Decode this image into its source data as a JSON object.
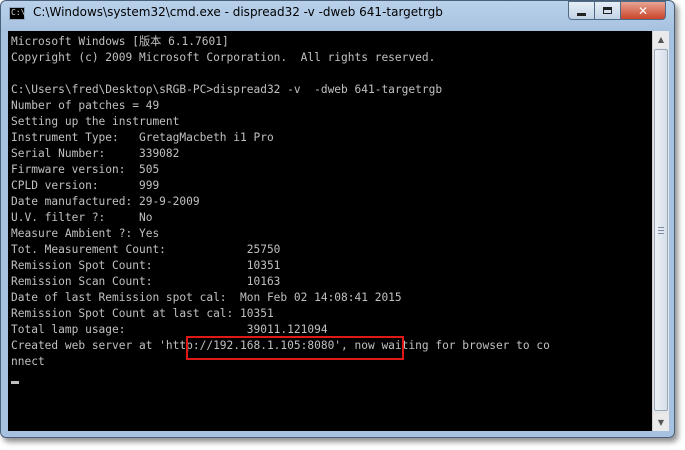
{
  "window": {
    "title": "C:\\Windows\\system32\\cmd.exe - dispread32  -v  -dweb 641-targetrgb",
    "app_icon_glyph": "C:\\"
  },
  "caption_buttons": {
    "minimize": "minimize",
    "maximize": "maximize",
    "close": "✕"
  },
  "console": {
    "lines": [
      "Microsoft Windows [版本 6.1.7601]",
      "Copyright (c) 2009 Microsoft Corporation.  All rights reserved.",
      "",
      "C:\\Users\\fred\\Desktop\\sRGB-PC>dispread32 -v  -dweb 641-targetrgb",
      "Number of patches = 49",
      "Setting up the instrument",
      "Instrument Type:   GretagMacbeth i1 Pro",
      "Serial Number:     339082",
      "Firmware version:  505",
      "CPLD version:      999",
      "Date manufactured: 29-9-2009",
      "U.V. filter ?:     No",
      "Measure Ambient ?: Yes",
      "Tot. Measurement Count:            25750",
      "Remission Spot Count:              10351",
      "Remission Scan Count:              10163",
      "Date of last Remission spot cal:  Mon Feb 02 14:08:41 2015",
      "Remission Spot Count at last cal: 10351",
      "Total lamp usage:                  39011.121094",
      "Created web server at 'http://192.168.1.105:8080', now waiting for browser to co",
      "nnect"
    ],
    "highlighted_url": "'http://192.168.1.105:8080'"
  }
}
